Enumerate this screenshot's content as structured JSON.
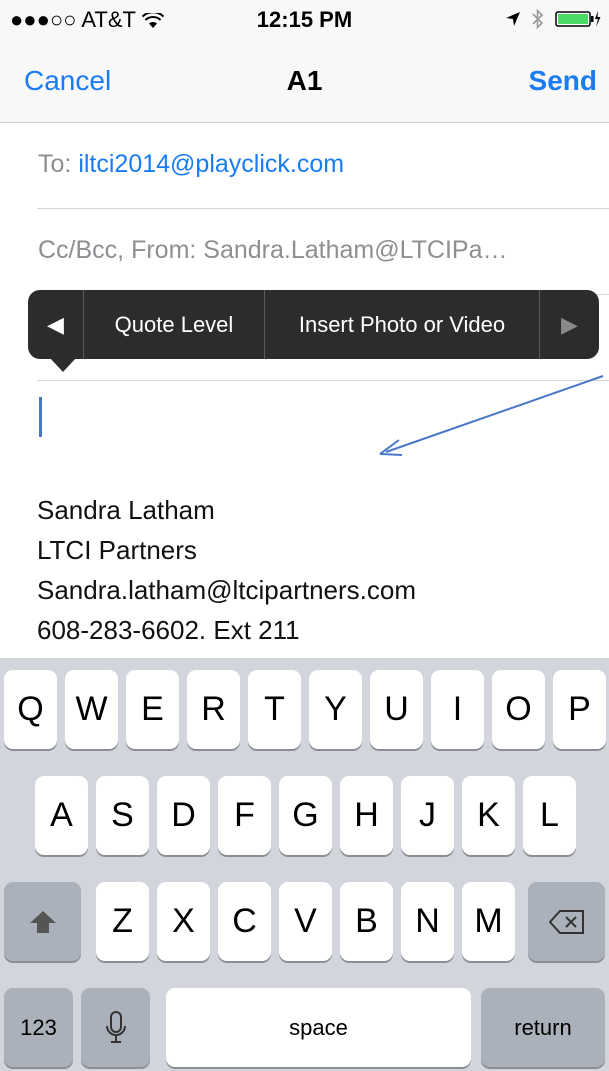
{
  "status_bar": {
    "signal": "●●●○○",
    "carrier": "AT&T",
    "wifi_icon": "wifi-icon",
    "time": "12:15 PM",
    "icons": [
      "location-icon",
      "bluetooth-icon",
      "battery-charging-icon"
    ]
  },
  "nav": {
    "cancel": "Cancel",
    "title": "A1",
    "send": "Send"
  },
  "fields": {
    "to_label": "To:",
    "to_value": "iltci2014@playclick.com",
    "cc_line": "Cc/Bcc, From: Sandra.Latham@LTCIPa…"
  },
  "edit_menu": {
    "left_arrow": "◀",
    "item1": "Quote Level",
    "item2": "Insert Photo or Video",
    "right_arrow": "▶"
  },
  "signature": {
    "line1": "Sandra Latham",
    "line2": "LTCI Partners",
    "line3": "Sandra.latham@ltcipartners.com",
    "line4": "608-283-6602. Ext 211"
  },
  "keyboard": {
    "row1": [
      "Q",
      "W",
      "E",
      "R",
      "T",
      "Y",
      "U",
      "I",
      "O",
      "P"
    ],
    "row2": [
      "A",
      "S",
      "D",
      "F",
      "G",
      "H",
      "J",
      "K",
      "L"
    ],
    "row3": [
      "Z",
      "X",
      "C",
      "V",
      "B",
      "N",
      "M"
    ],
    "numbers": "123",
    "space": "space",
    "return": "return",
    "shift_icon": "shift-icon",
    "delete_icon": "delete-icon",
    "mic_icon": "microphone-icon"
  },
  "colors": {
    "ios_blue": "#1a7cf3",
    "keyboard_bg": "#d2d5db",
    "menu_bg": "#2c2c2c"
  }
}
